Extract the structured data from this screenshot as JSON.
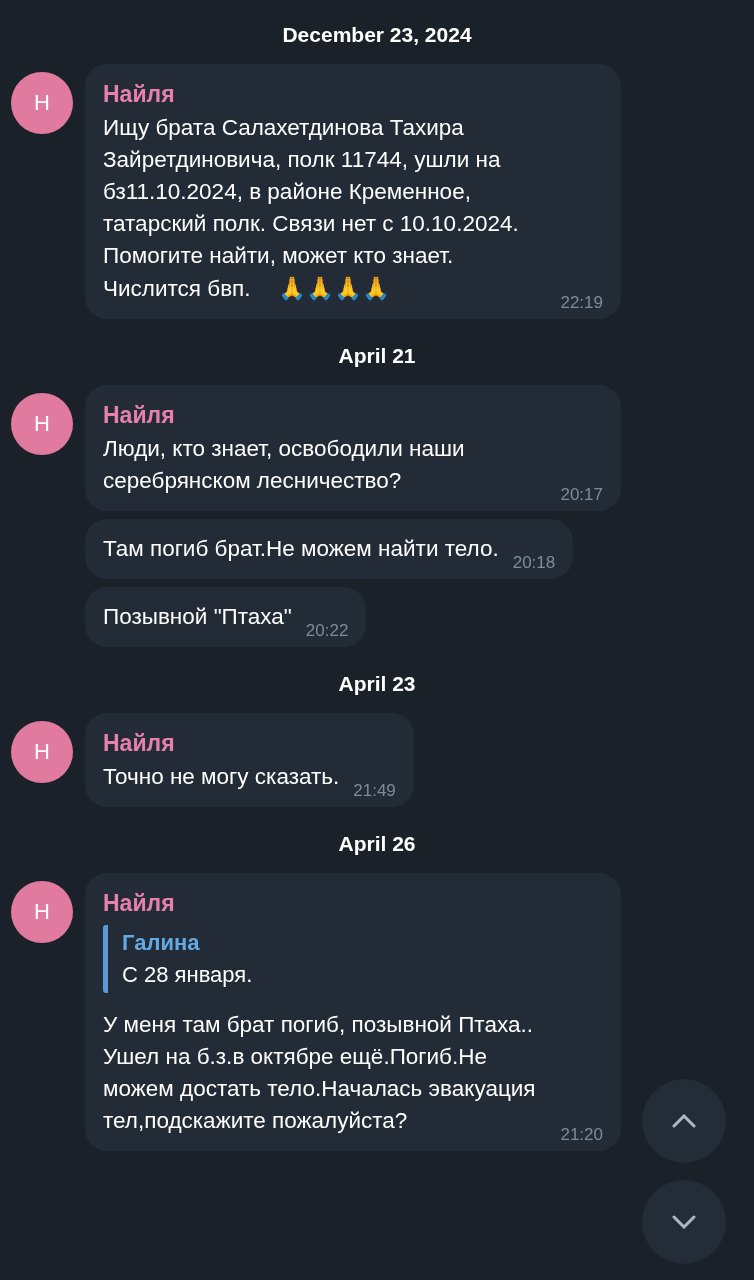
{
  "days": [
    {
      "date": "December 23, 2024",
      "groups": [
        {
          "avatar": "Н",
          "messages": [
            {
              "author": "Найля",
              "text": "Ищу брата Салахетдинова Тахира Зайретдиновича, полк 11744, ушли на бз11.10.2024, в районе Кременное, татарский полк. Связи нет с 10.10.2024. Помогите найти, может кто знает. Числится бвп.",
              "emoji": "🙏🙏🙏🙏",
              "time": "22:19"
            }
          ]
        }
      ]
    },
    {
      "date": "April 21",
      "groups": [
        {
          "avatar": "Н",
          "messages": [
            {
              "author": "Найля",
              "text": "Люди, кто знает, освободили наши серебрянском лесничество?",
              "time": "20:17"
            },
            {
              "text": "Там погиб брат.Не можем найти тело.",
              "time": "20:18"
            },
            {
              "text": "Позывной \"Птаха\"",
              "time": "20:22"
            }
          ]
        }
      ]
    },
    {
      "date": "April 23",
      "groups": [
        {
          "avatar": "Н",
          "messages": [
            {
              "author": "Найля",
              "text": "Точно не могу сказать.",
              "time": "21:49"
            }
          ]
        }
      ]
    },
    {
      "date": "April 26",
      "groups": [
        {
          "avatar": "Н",
          "messages": [
            {
              "author": "Найля",
              "reply": {
                "author": "Галина",
                "text": "С 28 января."
              },
              "text": "У меня там брат погиб, позывной Птаха.. Ушел на б.з.в октябре ещё.Погиб.Не можем достать тело.Началась эвакуация тел,подскажите пожалуйста?",
              "time": "21:20"
            }
          ]
        }
      ]
    }
  ]
}
